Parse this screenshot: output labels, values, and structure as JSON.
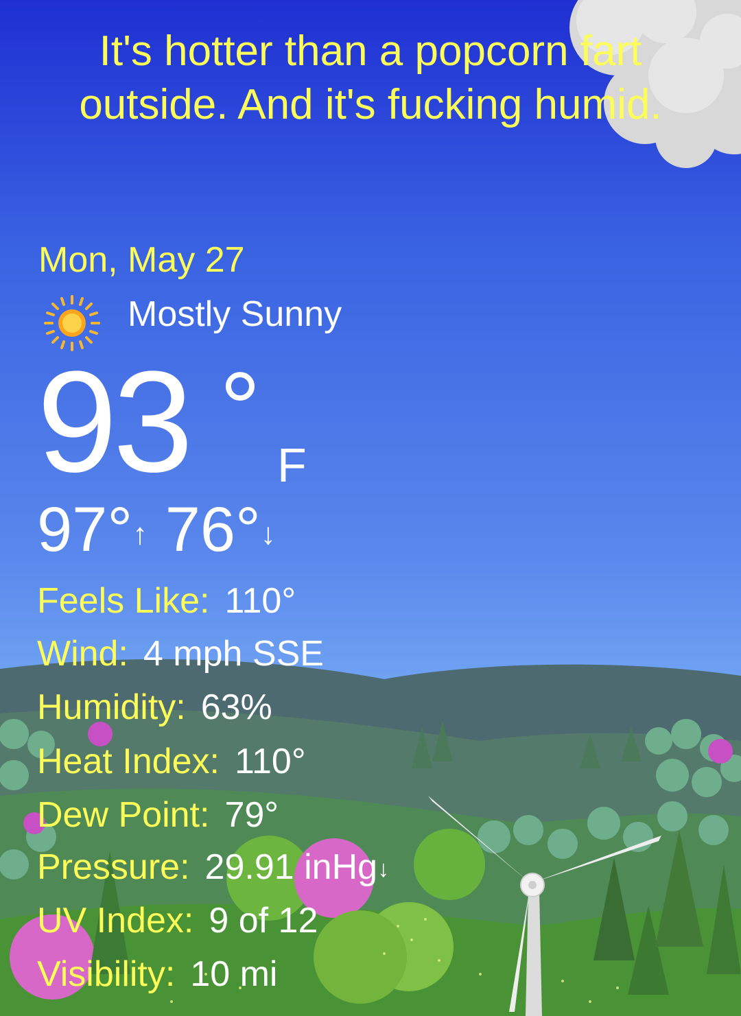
{
  "headline": {
    "line1": "It's hotter than a popcorn fart",
    "line2": "outside. And it's fucking humid."
  },
  "date": "Mon, May 27",
  "condition": {
    "icon": "sun-icon",
    "label": "Mostly Sunny"
  },
  "temperature": {
    "value": "93",
    "degree": "°",
    "unit": "F"
  },
  "high": {
    "value": "97°",
    "arrow": "↑"
  },
  "low": {
    "value": "76°",
    "arrow": "↓"
  },
  "details": [
    {
      "label": "Feels Like:",
      "value": "110°"
    },
    {
      "label": "Wind:",
      "value": "4 mph SSE"
    },
    {
      "label": "Humidity:",
      "value": "63%"
    },
    {
      "label": "Heat Index:",
      "value": "110°"
    },
    {
      "label": "Dew Point:",
      "value": "79°"
    },
    {
      "label": "Pressure:",
      "value": "29.91 inHg",
      "suffix": "↓"
    },
    {
      "label": "UV Index:",
      "value": "9 of 12"
    },
    {
      "label": "Visibility:",
      "value": "10 mi"
    }
  ],
  "colors": {
    "label": "#fdfd5a",
    "value": "#ffffff",
    "sky_top": "#1f2fd2",
    "sky_bottom": "#7cb0f2"
  }
}
